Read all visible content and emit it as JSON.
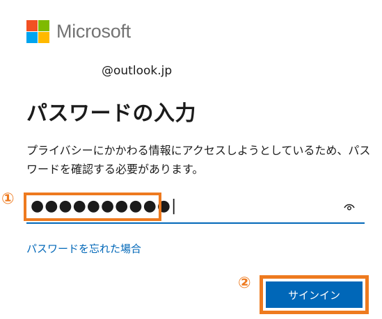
{
  "brand": {
    "name": "Microsoft",
    "logo_colors": [
      "#f25022",
      "#7fba00",
      "#00a4ef",
      "#ffb900"
    ]
  },
  "account": {
    "email": "@outlook.jp"
  },
  "heading": {
    "title": "パスワードの入力",
    "description": "プライバシーにかかわる情報にアクセスしようとしているため、パスワードを確認する必要があります。"
  },
  "password": {
    "value": "●●●●●●●●●●|",
    "show_password_icon": "eye-icon"
  },
  "links": {
    "forgot_password": "パスワードを忘れた場合"
  },
  "actions": {
    "signin_label": "サインイン"
  },
  "callouts": {
    "step1": "①",
    "step2": "②"
  },
  "colors": {
    "accent": "#0067b8",
    "highlight": "#ee7a1f"
  }
}
